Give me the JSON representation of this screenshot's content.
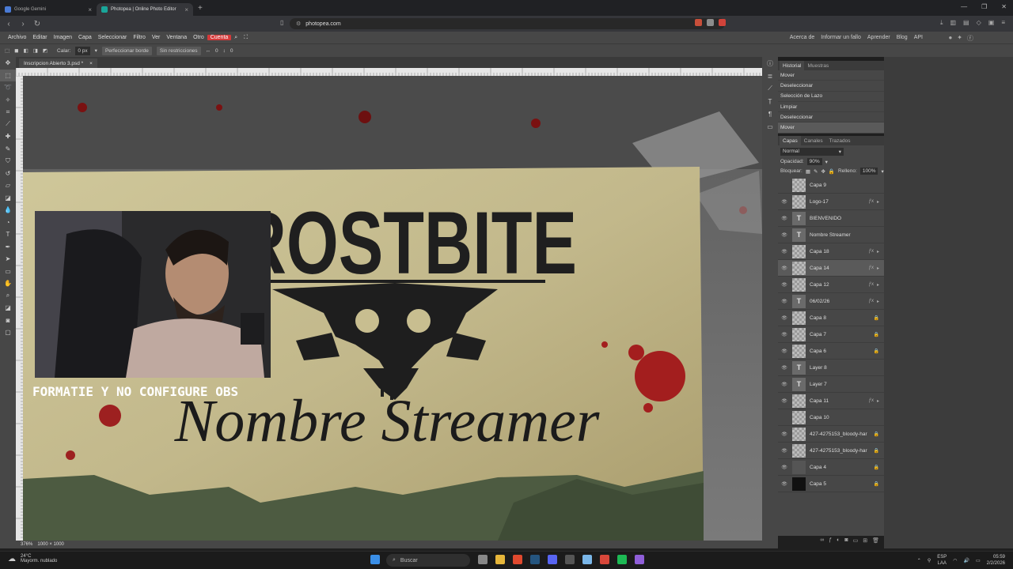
{
  "browser": {
    "tabs": [
      {
        "title": "Google Gemini",
        "active": false
      },
      {
        "title": "Photopea | Online Photo Editor",
        "active": true
      }
    ],
    "url": "photopea.com"
  },
  "menu": {
    "items": [
      "Archivo",
      "Editar",
      "Imagen",
      "Capa",
      "Seleccionar",
      "Filtro",
      "Ver",
      "Ventana",
      "Otro"
    ],
    "account": "Cuenta",
    "right": [
      "Acerca de",
      "Informar un fallo",
      "Aprender",
      "Blog",
      "API"
    ]
  },
  "options": {
    "feather_label": "Calar:",
    "feather_value": "0 px",
    "refine": "Perfeccionar borde",
    "constraint": "Sin restricciones",
    "w": "0",
    "h": "0"
  },
  "document": {
    "tab_name": "Inscripcion Abierto 3.psd *",
    "zoom": "376%",
    "size": "1000 × 1000"
  },
  "artwork": {
    "title": "FROSTBITE",
    "script": "Nombre Streamer",
    "overlay_caption": "FORMATIE Y NO CONFIGURE OBS"
  },
  "history": {
    "tabs": [
      "Historial",
      "Muestras"
    ],
    "items": [
      "Mover",
      "Deseleccionar",
      "Selección de Lazo",
      "Limpiar",
      "Deseleccionar",
      "Mover"
    ]
  },
  "layers_panel": {
    "tabs": [
      "Capas",
      "Canales",
      "Trazados"
    ],
    "blend_mode": "Normal",
    "opacity_label": "Opacidad:",
    "opacity": "90%",
    "lock_label": "Bloquear:",
    "fill_label": "Relleno:",
    "fill": "100%",
    "layers": [
      {
        "name": "Capa 9",
        "kind": "raster",
        "visible": false,
        "fx": false,
        "locked": false
      },
      {
        "name": "Logo-17",
        "kind": "raster",
        "visible": true,
        "fx": true,
        "locked": false
      },
      {
        "name": "BIENVENIDO",
        "kind": "text",
        "visible": true,
        "fx": false,
        "locked": false
      },
      {
        "name": "Nombre Streamer",
        "kind": "text",
        "visible": true,
        "fx": false,
        "locked": false
      },
      {
        "name": "Capa 18",
        "kind": "raster",
        "visible": true,
        "fx": true,
        "locked": false
      },
      {
        "name": "Capa 14",
        "kind": "raster",
        "visible": true,
        "fx": true,
        "locked": false,
        "selected": true
      },
      {
        "name": "Capa 12",
        "kind": "raster",
        "visible": true,
        "fx": true,
        "locked": false
      },
      {
        "name": "06/02/26",
        "kind": "text",
        "visible": true,
        "fx": true,
        "locked": false
      },
      {
        "name": "Capa 8",
        "kind": "raster",
        "visible": true,
        "fx": false,
        "locked": true
      },
      {
        "name": "Capa 7",
        "kind": "raster",
        "visible": true,
        "fx": false,
        "locked": true
      },
      {
        "name": "Capa 6",
        "kind": "raster",
        "visible": true,
        "fx": false,
        "locked": true
      },
      {
        "name": "Layer 8",
        "kind": "text",
        "visible": true,
        "fx": false,
        "locked": false
      },
      {
        "name": "Layer 7",
        "kind": "text",
        "visible": true,
        "fx": false,
        "locked": false
      },
      {
        "name": "Capa 11",
        "kind": "raster",
        "visible": true,
        "fx": true,
        "locked": false
      },
      {
        "name": "Capa 10",
        "kind": "raster",
        "visible": false,
        "fx": false,
        "locked": false
      },
      {
        "name": "427-4275153_bloody-har",
        "kind": "raster",
        "visible": true,
        "fx": false,
        "locked": true
      },
      {
        "name": "427-4275153_bloody-har",
        "kind": "raster",
        "visible": true,
        "fx": false,
        "locked": true
      },
      {
        "name": "Capa 4",
        "kind": "photo",
        "visible": true,
        "fx": false,
        "locked": true
      },
      {
        "name": "Capa 5",
        "kind": "dark",
        "visible": true,
        "fx": false,
        "locked": true
      }
    ]
  },
  "taskbar": {
    "temperature": "24°C",
    "weather": "Mayorm. nublado",
    "search_placeholder": "Buscar",
    "lang_1": "ESP",
    "lang_2": "LAA",
    "time": "05:59",
    "date": "2/2/2026"
  }
}
